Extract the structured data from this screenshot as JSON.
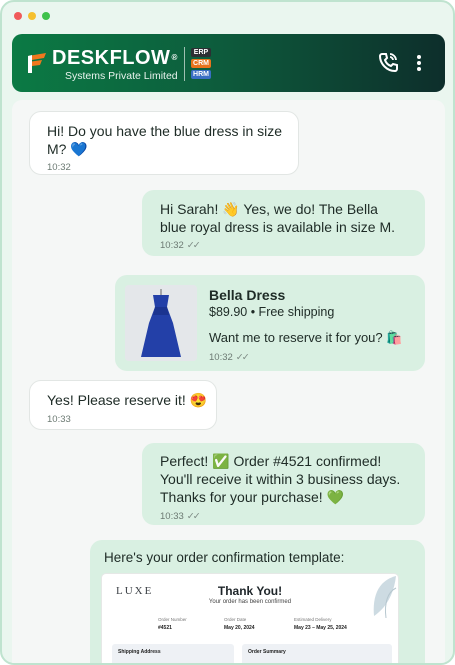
{
  "window": {
    "controls": [
      "close",
      "minimize",
      "maximize"
    ],
    "colors": [
      "#f05a5a",
      "#f5c02e",
      "#3fc24c"
    ]
  },
  "header": {
    "brand": "DESKFLOW",
    "reg_mark": "®",
    "tagline": "Systems Private Limited",
    "badges": [
      {
        "label": "ERP",
        "color": "#2d2f33"
      },
      {
        "label": "CRM",
        "color": "#e8731c"
      },
      {
        "label": "HRM",
        "color": "#3a6fc4"
      }
    ],
    "icons": {
      "call": "phone-call-icon",
      "menu": "more-vertical-icon"
    },
    "logo_colors": [
      "#f0781e",
      "#ffffff"
    ]
  },
  "messages": [
    {
      "dir": "in",
      "text_lines": [
        "Hi! Do you have the blue dress in size",
        "M? 💙"
      ],
      "time": "10:32"
    },
    {
      "dir": "out",
      "text_lines": [
        "Hi Sarah! 👋 Yes, we do! The Bella",
        "blue royal dress is available in size M."
      ],
      "time": "10:32",
      "ticks": "✓✓"
    },
    {
      "dir": "out",
      "product": {
        "title": "Bella Dress",
        "subtitle": "$89.90 • Free shipping",
        "ask": "Want me to reserve it for you? 🛍️"
      },
      "time": "10:32",
      "ticks": "✓✓"
    },
    {
      "dir": "in",
      "text_lines": [
        "Yes! Please reserve it! 😍"
      ],
      "time": "10:33"
    },
    {
      "dir": "out",
      "text_lines": [
        "Perfect! ✅ Order #4521 confirmed!",
        "You'll receive it within 3 business days.",
        "Thanks for your purchase! 💚"
      ],
      "time": "10:33",
      "ticks": "✓✓"
    },
    {
      "dir": "out",
      "text_lines": [
        "Here's your order confirmation template:"
      ]
    }
  ],
  "template": {
    "brand": "LUXE",
    "title": "Thank You!",
    "subtitle": "Your order has been confirmed",
    "fields": [
      {
        "label": "Order Number",
        "value": "#4521"
      },
      {
        "label": "Order Date",
        "value": "May 20, 2024"
      },
      {
        "label": "Estimated Delivery",
        "value": "May 23 – May 25, 2024"
      }
    ],
    "sections": [
      "Shipping Address",
      "Order Summary"
    ]
  }
}
